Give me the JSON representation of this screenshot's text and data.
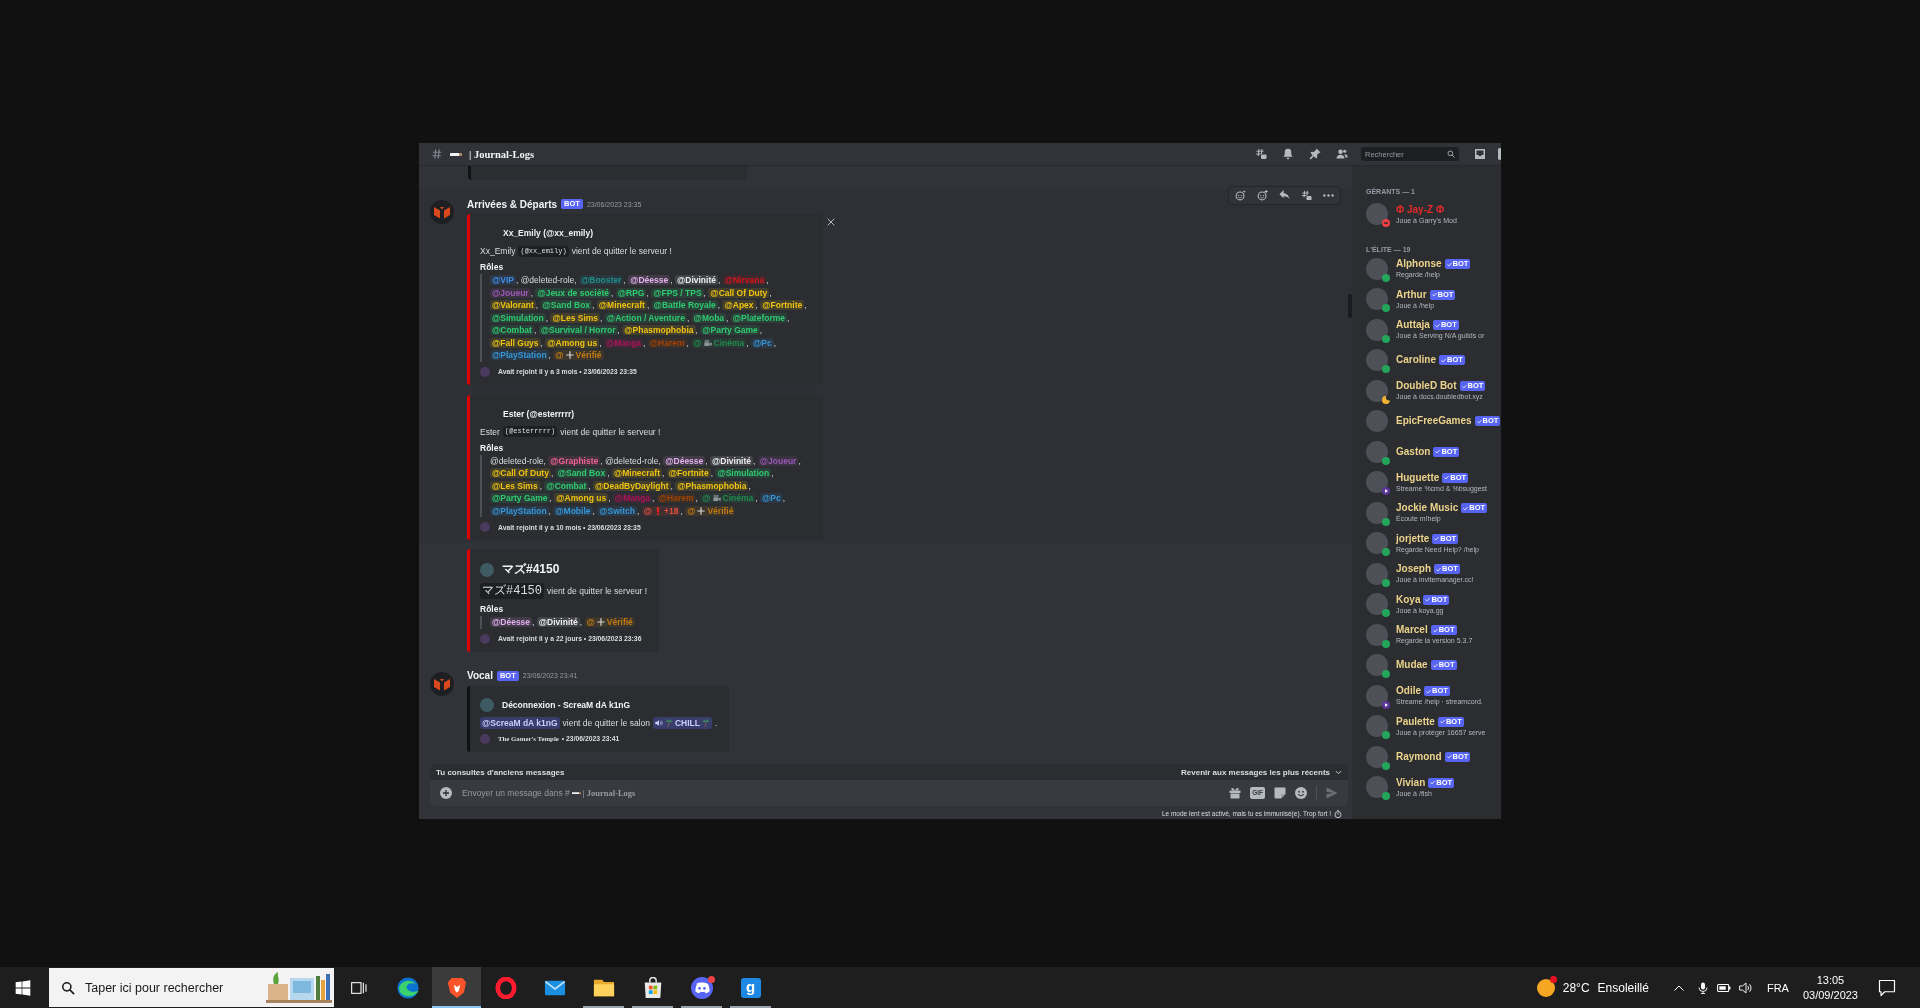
{
  "channel": {
    "title": "| Journal-Logs"
  },
  "search": {
    "placeholder": "Rechercher"
  },
  "previous_embed": {
    "color": "#111214"
  },
  "messages": [
    {
      "author": "Arrivées & Départs",
      "badge": "BOT",
      "time": "23/06/2023 23:35",
      "hovered": true,
      "embeds": [
        {
          "color": "#e00000",
          "author": "Xx_Emily (@xx_emily)",
          "author_icon": false,
          "closable": true,
          "description": [
            {
              "kind": "name",
              "text": "Xx_Emily"
            },
            {
              "kind": "code",
              "text": "(@xx_emily)"
            },
            {
              "kind": "text",
              "text": "vient de quitter le serveur !"
            }
          ],
          "field": {
            "title": "Rôles",
            "separator": ",",
            "roles": [
              {
                "kind": "role",
                "label": "@VIP",
                "color": "#3b8eea"
              },
              {
                "kind": "deleted",
                "label": "@deleted-role"
              },
              {
                "kind": "role",
                "label": "@Booster",
                "color": "#1f8f8f"
              },
              {
                "kind": "role",
                "label": "@Déesse",
                "color": "#e4b0ee"
              },
              {
                "kind": "role",
                "label": "@Divinité",
                "color": "#eeeeee"
              },
              {
                "kind": "role",
                "label": "@Nirvana",
                "color": "#d9141b"
              },
              {
                "kind": "role",
                "label": "@Joueur",
                "color": "#9b59b6"
              },
              {
                "kind": "role",
                "label": "@Jeux de société",
                "color": "#2ecc71"
              },
              {
                "kind": "role",
                "label": "@RPG",
                "color": "#2ecc71"
              },
              {
                "kind": "role",
                "label": "@FPS / TPS",
                "color": "#2ecc71"
              },
              {
                "kind": "role",
                "label": "@Call Of Duty",
                "color": "#f1c40f"
              },
              {
                "kind": "role",
                "label": "@Valorant",
                "color": "#f1c40f"
              },
              {
                "kind": "role",
                "label": "@Sand Box",
                "color": "#2ecc71"
              },
              {
                "kind": "role",
                "label": "@Minecraft",
                "color": "#f1c40f"
              },
              {
                "kind": "role",
                "label": "@Battle Royale",
                "color": "#2ecc71"
              },
              {
                "kind": "role",
                "label": "@Apex",
                "color": "#f1c40f"
              },
              {
                "kind": "role",
                "label": "@Fortnite",
                "color": "#f1c40f"
              },
              {
                "kind": "role",
                "label": "@Simulation",
                "color": "#2ecc71"
              },
              {
                "kind": "role",
                "label": "@Les Sims",
                "color": "#f1c40f"
              },
              {
                "kind": "role",
                "label": "@Action / Aventure",
                "color": "#2ecc71"
              },
              {
                "kind": "role",
                "label": "@Moba",
                "color": "#2ecc71"
              },
              {
                "kind": "role",
                "label": "@Plateforme",
                "color": "#2ecc71"
              },
              {
                "kind": "role",
                "label": "@Combat",
                "color": "#2ecc71"
              },
              {
                "kind": "role",
                "label": "@Survival / Horror",
                "color": "#2ecc71"
              },
              {
                "kind": "role",
                "label": "@Phasmophobia",
                "color": "#f1c40f"
              },
              {
                "kind": "role",
                "label": "@Party Game",
                "color": "#2ecc71"
              },
              {
                "kind": "role",
                "label": "@Fall Guys",
                "color": "#f1c40f"
              },
              {
                "kind": "role",
                "label": "@Among us",
                "color": "#f1c40f"
              },
              {
                "kind": "role",
                "label": "@Manga",
                "color": "#ad1457"
              },
              {
                "kind": "role",
                "label": "@Harem",
                "color": "#a84300"
              },
              {
                "kind": "film",
                "prefix": "@",
                "label": "Cinéma",
                "color": "#1f8b4c"
              },
              {
                "kind": "role",
                "label": "@Pc",
                "color": "#3498db"
              },
              {
                "kind": "role",
                "label": "@PlayStation",
                "color": "#3498db"
              },
              {
                "kind": "plus",
                "prefix": "@",
                "label": "Vérifié",
                "color": "#c27c0e"
              }
            ]
          },
          "footer": {
            "text": "Avait rejoint il y a 3 mois • 23/06/2023 23:35"
          }
        },
        {
          "color": "#e00000",
          "author": "Ester (@esterrrrr)",
          "author_icon": false,
          "closable": false,
          "description": [
            {
              "kind": "name",
              "text": "Ester"
            },
            {
              "kind": "code",
              "text": "(@esterrrrr)"
            },
            {
              "kind": "text",
              "text": "vient de quitter le serveur !"
            }
          ],
          "field": {
            "title": "Rôles",
            "separator": ",",
            "roles": [
              {
                "kind": "deleted",
                "label": "@deleted-role"
              },
              {
                "kind": "role",
                "label": "@Graphiste",
                "color": "#f06292"
              },
              {
                "kind": "deleted",
                "label": "@deleted-role"
              },
              {
                "kind": "role",
                "label": "@Déesse",
                "color": "#e4b0ee"
              },
              {
                "kind": "role",
                "label": "@Divinité",
                "color": "#eeeeee"
              },
              {
                "kind": "role",
                "label": "@Joueur",
                "color": "#9b59b6"
              },
              {
                "kind": "role",
                "label": "@Call Of Duty",
                "color": "#f1c40f"
              },
              {
                "kind": "role",
                "label": "@Sand Box",
                "color": "#2ecc71"
              },
              {
                "kind": "role",
                "label": "@Minecraft",
                "color": "#f1c40f"
              },
              {
                "kind": "role",
                "label": "@Fortnite",
                "color": "#f1c40f"
              },
              {
                "kind": "role",
                "label": "@Simulation",
                "color": "#2ecc71"
              },
              {
                "kind": "role",
                "label": "@Les Sims",
                "color": "#f1c40f"
              },
              {
                "kind": "role",
                "label": "@Combat",
                "color": "#2ecc71"
              },
              {
                "kind": "role",
                "label": "@DeadByDaylight",
                "color": "#f1c40f"
              },
              {
                "kind": "role",
                "label": "@Phasmophobia",
                "color": "#f1c40f"
              },
              {
                "kind": "role",
                "label": "@Party Game",
                "color": "#2ecc71"
              },
              {
                "kind": "role",
                "label": "@Among us",
                "color": "#f1c40f"
              },
              {
                "kind": "role",
                "label": "@Manga",
                "color": "#ad1457"
              },
              {
                "kind": "role",
                "label": "@Harem",
                "color": "#a84300"
              },
              {
                "kind": "film",
                "prefix": "@",
                "label": "Cinéma",
                "color": "#1f8b4c"
              },
              {
                "kind": "role",
                "label": "@Pc",
                "color": "#3498db"
              },
              {
                "kind": "role",
                "label": "@PlayStation",
                "color": "#3498db"
              },
              {
                "kind": "role",
                "label": "@Mobile",
                "color": "#3498db"
              },
              {
                "kind": "role",
                "label": "@Switch",
                "color": "#3498db"
              },
              {
                "kind": "alert",
                "prefix": "@",
                "label": "+18",
                "color": "#e74c3c"
              },
              {
                "kind": "plus",
                "prefix": "@",
                "label": "Vérifié",
                "color": "#c27c0e"
              }
            ]
          },
          "footer": {
            "text": "Avait rejoint il y a 10 mois • 23/06/2023 23:35"
          }
        }
      ]
    },
    {
      "hovered": false,
      "embeds": [
        {
          "color": "#e00000",
          "author": "マズ#4150",
          "author_icon": true,
          "closable": false,
          "description": [
            {
              "kind": "code",
              "text": "マズ#4150"
            },
            {
              "kind": "text",
              "text": "vient de quitter le serveur !"
            }
          ],
          "field": {
            "title": "Rôles",
            "separator": ",",
            "roles": [
              {
                "kind": "role",
                "label": "@Déesse",
                "color": "#e4b0ee"
              },
              {
                "kind": "role",
                "label": "@Divinité",
                "color": "#eeeeee"
              },
              {
                "kind": "plus",
                "prefix": "@",
                "label": "Vérifié",
                "color": "#c27c0e"
              }
            ]
          },
          "footer": {
            "text": "Avait rejoint il y a 22 jours • 23/06/2023 23:36"
          }
        }
      ]
    },
    {
      "author": "Vocal",
      "badge": "BOT",
      "time": "23/06/2023 23:41",
      "hovered": false,
      "embeds": [
        {
          "color": "#111214",
          "author": "Déconnexion - ScreaM dA k1nG",
          "author_icon": true,
          "closable": false,
          "description": [
            {
              "kind": "mention",
              "text": "@ScreaM dA k1nG"
            },
            {
              "kind": "text",
              "text": "vient de quitter le salon"
            },
            {
              "kind": "channel",
              "text": "CHILL"
            },
            {
              "kind": "text",
              "text": "."
            }
          ],
          "footer": {
            "source": "The Gamer's Temple",
            "text": "• 23/06/2023 23:41"
          }
        }
      ]
    }
  ],
  "composer": {
    "notice": "Tu consultes d'anciens messages",
    "jump": "Revenir aux messages les plus récents",
    "placeholder": [
      "Envoyer un message dans #",
      "| Journal-Logs"
    ],
    "gif": "GIF",
    "slowmode": "Le mode lent est activé, mais tu es immunisé(e). Trop fort !"
  },
  "members": {
    "sections": [
      {
        "title": "GÉRANTS — 1",
        "color": "#e12a2a",
        "members": [
          {
            "name": "Φ Jay-Z Φ",
            "activity": "Joue à Garry's Mod",
            "status": {
              "kind": "dnd",
              "color": "#f23f43"
            }
          }
        ]
      },
      {
        "title": "L'ÉLITE — 19",
        "color": "#ecd38c",
        "members": [
          {
            "name": "Alphonse",
            "badge": "BOT",
            "verified": true,
            "activity": "Regarde /help",
            "status": {
              "kind": "online",
              "color": "#23a55a"
            }
          },
          {
            "name": "Arthur",
            "badge": "BOT",
            "verified": true,
            "activity": "Joue à /help",
            "status": {
              "kind": "online",
              "color": "#23a55a"
            }
          },
          {
            "name": "Auttaja",
            "badge": "BOT",
            "verified": true,
            "activity": "Joue à Serving N/A guilds or",
            "status": {
              "kind": "online",
              "color": "#23a55a"
            }
          },
          {
            "name": "Caroline",
            "badge": "BOT",
            "verified": true,
            "status": {
              "kind": "online",
              "color": "#23a55a"
            }
          },
          {
            "name": "DoubleD Bot",
            "badge": "BOT",
            "verified": true,
            "activity": "Joue à docs.doubledbot.xyz",
            "status": {
              "kind": "idle",
              "color": "#f0b232"
            }
          },
          {
            "name": "EpicFreeGames",
            "badge": "BOT",
            "verified": true
          },
          {
            "name": "Gaston",
            "badge": "BOT",
            "verified": true,
            "status": {
              "kind": "online",
              "color": "#23a55a"
            }
          },
          {
            "name": "Huguette",
            "badge": "BOT",
            "verified": true,
            "activity": "Streame %cmd & %bsuggest",
            "status": {
              "kind": "streaming",
              "color": "#593695"
            }
          },
          {
            "name": "Jockie Music",
            "badge": "BOT",
            "verified": true,
            "activity": "Écoute m!help",
            "status": {
              "kind": "online",
              "color": "#23a55a"
            }
          },
          {
            "name": "jorjette",
            "badge": "BOT",
            "verified": true,
            "activity": "Regarde Need Help? /help",
            "status": {
              "kind": "online",
              "color": "#23a55a"
            }
          },
          {
            "name": "Joseph",
            "badge": "BOT",
            "verified": true,
            "activity": "Joue à invitemanager.cc!",
            "status": {
              "kind": "online",
              "color": "#23a55a"
            }
          },
          {
            "name": "Koya",
            "badge": "BOT",
            "verified": true,
            "activity": "Joue à koya.gg",
            "status": {
              "kind": "online",
              "color": "#23a55a"
            }
          },
          {
            "name": "Marcel",
            "badge": "BOT",
            "verified": true,
            "activity": "Regarde la version 5.3.7",
            "status": {
              "kind": "online",
              "color": "#23a55a"
            }
          },
          {
            "name": "Mudae",
            "badge": "BOT",
            "verified": true,
            "status": {
              "kind": "online",
              "color": "#23a55a"
            }
          },
          {
            "name": "Odile",
            "badge": "BOT",
            "verified": true,
            "activity": "Streame /help · streamcord.",
            "status": {
              "kind": "streaming",
              "color": "#593695"
            }
          },
          {
            "name": "Paulette",
            "badge": "BOT",
            "verified": true,
            "activity": "Joue à protéger 16657 serve",
            "status": {
              "kind": "online",
              "color": "#23a55a"
            }
          },
          {
            "name": "Raymond",
            "badge": "BOT",
            "verified": true,
            "status": {
              "kind": "online",
              "color": "#23a55a"
            }
          },
          {
            "name": "Vivian",
            "badge": "BOT",
            "verified": true,
            "activity": "Joue à /fish",
            "status": {
              "kind": "online",
              "color": "#23a55a"
            }
          }
        ]
      }
    ]
  },
  "taskbar": {
    "search": {
      "placeholder": "Taper ici pour rechercher"
    },
    "apps": [
      {
        "kind": "edge",
        "running": false,
        "selected": false
      },
      {
        "kind": "brave",
        "running": true,
        "selected": true
      },
      {
        "kind": "opera",
        "running": false,
        "selected": false
      },
      {
        "kind": "mail",
        "running": false,
        "selected": false
      },
      {
        "kind": "folder",
        "running": true,
        "selected": false
      },
      {
        "kind": "store",
        "running": true,
        "selected": false
      },
      {
        "kind": "discord",
        "running": true,
        "selected": false,
        "notification": true
      },
      {
        "kind": "letter",
        "label": "g",
        "running": true,
        "selected": false
      }
    ],
    "weather": {
      "temperature": "28°C",
      "condition": "Ensoleillé"
    },
    "language": "FRA",
    "time": "13:05",
    "date": "03/09/2023"
  }
}
